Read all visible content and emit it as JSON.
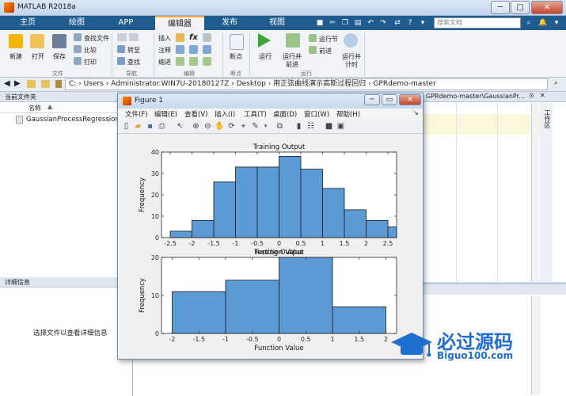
{
  "window": {
    "title": "MATLAB R2018a",
    "min": "─",
    "max": "□",
    "close": "✕"
  },
  "tabs": [
    {
      "label": "主页"
    },
    {
      "label": "绘图"
    },
    {
      "label": "APP"
    },
    {
      "label": "编辑器"
    },
    {
      "label": "发布"
    },
    {
      "label": "视图"
    }
  ],
  "search": {
    "placeholder": "搜索文档"
  },
  "ribbon": {
    "file": {
      "new": "新建",
      "open": "打开",
      "save": "保存",
      "find_files": "查找文件",
      "compare": "比较",
      "print": "打印",
      "group": "文件"
    },
    "nav": {
      "goto": "转至",
      "find": "查找",
      "group": "导航"
    },
    "edit": {
      "insert": "插入",
      "comment": "注释",
      "indent": "缩进",
      "fx": "fx",
      "group": "编辑"
    },
    "breakpoints": {
      "label": "断点",
      "group": "断点"
    },
    "run": {
      "run": "运行",
      "run_advance_1": "运行并",
      "run_advance_2": "前进",
      "run_section": "运行节",
      "advance": "前进",
      "run_time_1": "运行并",
      "run_time_2": "计时",
      "group": "运行"
    }
  },
  "address": {
    "crumbs": "C: › Users › Administrator.WIN7U-20180127Z › Desktop › 用正弦曲线演示高斯过程回归 › GPRdemo-master"
  },
  "left_panel": {
    "title": "当前文件夹",
    "col_name": "名称",
    "files": [
      "GaussianProcessRegression.m"
    ],
    "details_title": "详细信息",
    "details_msg": "选择文件以查看详细信息"
  },
  "editor": {
    "path_fragment": "GPRdemo-master\\GaussianPr..."
  },
  "right_strip": {
    "label": "工作区"
  },
  "figure": {
    "title": "Figure 1",
    "menu": [
      "文件(F)",
      "编辑(E)",
      "查看(V)",
      "插入(I)",
      "工具(T)",
      "桌面(D)",
      "窗口(W)",
      "帮助(H)"
    ]
  },
  "chart_data": [
    {
      "type": "bar",
      "title": "Training Output",
      "xlabel": "Function Value",
      "ylabel": "Frequency",
      "xlim": [
        -2.7,
        2.7
      ],
      "ylim": [
        0,
        40
      ],
      "xticks": [
        -2.5,
        -2,
        -1.5,
        -1,
        -0.5,
        0,
        0.5,
        1,
        1.5,
        2,
        2.5
      ],
      "xtick_labels": [
        "-2.5",
        "-2",
        "-1.5",
        "-1",
        "-0.5",
        "0",
        "0.5",
        "1",
        "1.5",
        "2",
        "2.5"
      ],
      "yticks": [
        0,
        10,
        20,
        30,
        40
      ],
      "ytick_labels": [
        "0",
        "10",
        "20",
        "30",
        "40"
      ],
      "bins": [
        [
          -2.5,
          -2
        ],
        [
          -2,
          -1.5
        ],
        [
          -1.5,
          -1
        ],
        [
          -1,
          -0.5
        ],
        [
          -0.5,
          0
        ],
        [
          0,
          0.5
        ],
        [
          0.5,
          1
        ],
        [
          1,
          1.5
        ],
        [
          1.5,
          2
        ],
        [
          2,
          2.5
        ]
      ],
      "values": [
        3,
        8,
        26,
        33,
        33,
        38,
        32,
        23,
        13,
        8
      ],
      "extra_bins": [
        [
          2.5,
          2.75,
          5
        ]
      ],
      "color": "#5b9bd5"
    },
    {
      "type": "bar",
      "title": "Testing Output",
      "xlabel": "Function Value",
      "ylabel": "Frequency",
      "xlim": [
        -2.2,
        2.2
      ],
      "ylim": [
        0,
        20
      ],
      "xticks": [
        -2,
        -1.5,
        -1,
        -0.5,
        0,
        0.5,
        1,
        1.5,
        2
      ],
      "xtick_labels": [
        "-2",
        "-1.5",
        "-1",
        "-0.5",
        "0",
        "0.5",
        "1",
        "1.5",
        "2"
      ],
      "yticks": [
        0,
        10,
        20
      ],
      "ytick_labels": [
        "0",
        "10",
        "20"
      ],
      "bins": [
        [
          -2,
          -1
        ],
        [
          -1,
          0
        ],
        [
          0,
          1
        ],
        [
          1,
          2
        ]
      ],
      "values": [
        11,
        14,
        21,
        7
      ],
      "color": "#5b9bd5"
    }
  ],
  "watermark": {
    "cn": "必过源码",
    "url": "Biguo100.com"
  }
}
